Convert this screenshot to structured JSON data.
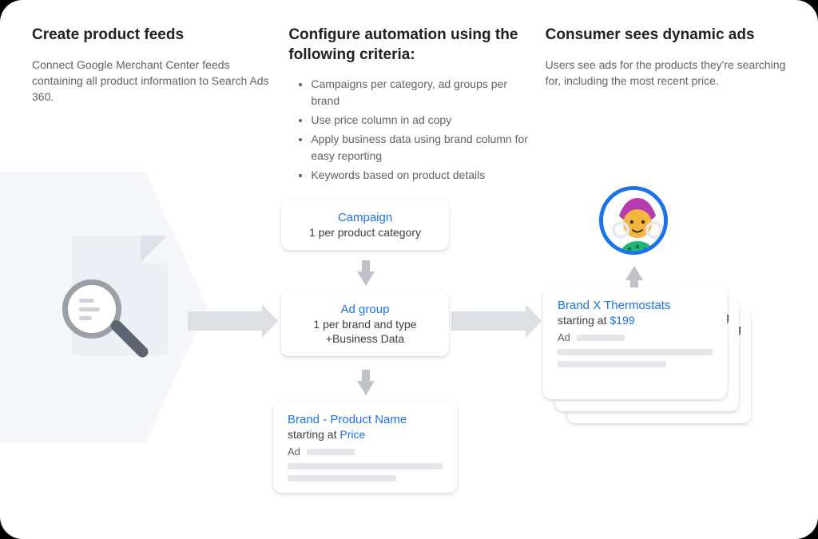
{
  "col1": {
    "title": "Create product feeds",
    "body": "Connect Google Merchant Center feeds containing all product information to Search Ads 360."
  },
  "col2": {
    "title": "Configure automation using the following criteria:",
    "bullets": [
      "Campaigns per category, ad groups per brand",
      "Use price column in ad copy",
      "Apply business data using brand column for easy reporting",
      "Keywords based on product details"
    ]
  },
  "col3": {
    "title": "Consumer sees dynamic ads",
    "body": "Users see ads for the products they're searching for, including the most recent price."
  },
  "cards": {
    "campaign": {
      "title": "Campaign",
      "sub": "1 per product category"
    },
    "adgroup": {
      "title": "Ad group",
      "sub": "1 per brand and type",
      "extra": "+Business Data"
    },
    "template": {
      "h1": "Brand - Product Name",
      "h2_a": "starting at ",
      "h2_b": "Price",
      "adlabel": "Ad"
    },
    "result": {
      "h1": "Brand X Thermostats",
      "h2_a": "starting at ",
      "h2_b": "$199",
      "adlabel": "Ad",
      "tail": "g"
    }
  }
}
